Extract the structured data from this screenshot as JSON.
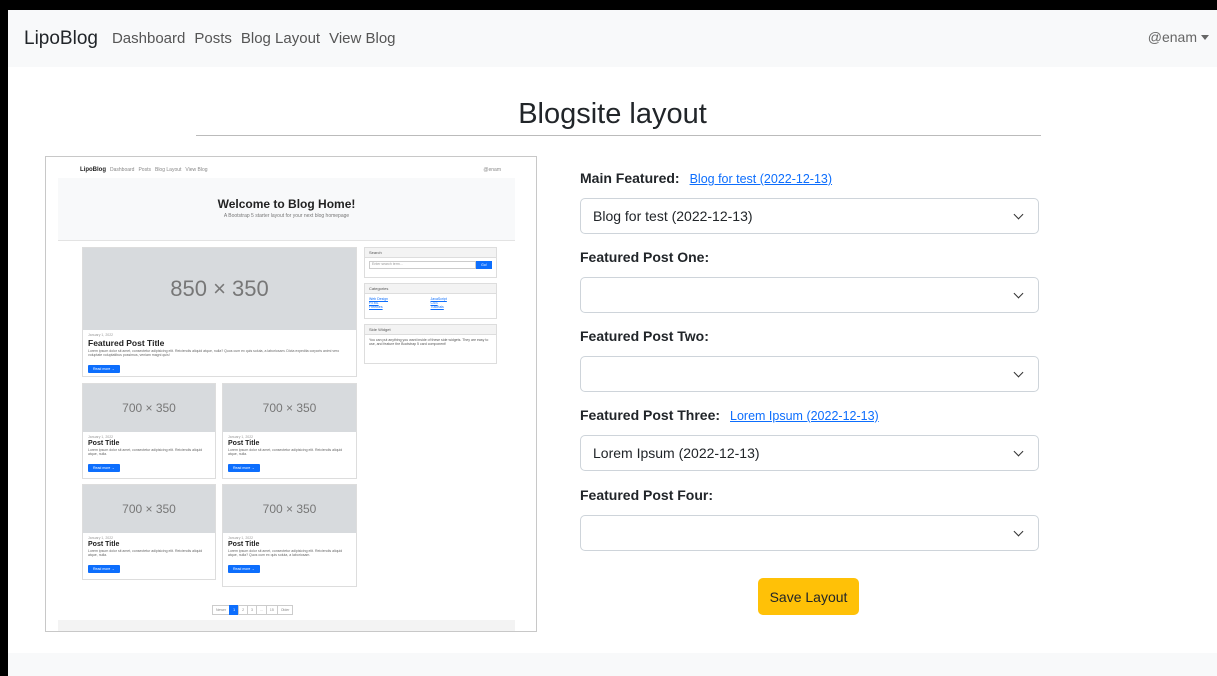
{
  "navbar": {
    "brand": "LipoBlog",
    "links": [
      "Dashboard",
      "Posts",
      "Blog Layout",
      "View Blog"
    ],
    "user": "@enam"
  },
  "page": {
    "title": "Blogsite layout"
  },
  "preview": {
    "nav_brand": "LipoBlog",
    "nav_links": [
      "Dashboard",
      "Posts",
      "Blog Layout",
      "View Blog"
    ],
    "nav_user": "@enam",
    "heading": "Welcome to Blog Home!",
    "lead": "A Bootstrap 5 starter layout for your next blog homepage",
    "featured": {
      "image": "850 × 350",
      "date": "January 1, 2022",
      "title": "Featured Post Title",
      "text": "Lorem ipsum dolor sit amet, consectetur adipisicing elit. Reiciendis aliquid atque, nulla? Quos cum ex quis soluta, a laboriosam. Dicta expedita corporis animi vero voluptate voluptatibus possimus, veniam magni quis!",
      "button": "Read more →"
    },
    "posts": [
      {
        "image": "700 × 350",
        "date": "January 1, 2022",
        "title": "Post Title",
        "text": "Lorem ipsum dolor sit amet, consectetur adipisicing elit. Reiciendis aliquid atque, nulla.",
        "button": "Read more →"
      },
      {
        "image": "700 × 350",
        "date": "January 1, 2022",
        "title": "Post Title",
        "text": "Lorem ipsum dolor sit amet, consectetur adipisicing elit. Reiciendis aliquid atque, nulla.",
        "button": "Read more →"
      },
      {
        "image": "700 × 350",
        "date": "January 1, 2022",
        "title": "Post Title",
        "text": "Lorem ipsum dolor sit amet, consectetur adipisicing elit. Reiciendis aliquid atque, nulla.",
        "button": "Read more →"
      },
      {
        "image": "700 × 350",
        "date": "January 1, 2022",
        "title": "Post Title",
        "text": "Lorem ipsum dolor sit amet, consectetur adipisicing elit. Reiciendis aliquid atque, nulla? Quos cum ex quis soluta, a laboriosam.",
        "button": "Read more →"
      }
    ],
    "search_title": "Search",
    "search_placeholder": "Enter search term...",
    "search_button": "Go!",
    "categories_title": "Categories",
    "categories_left": [
      "Web Design",
      "HTML",
      "Freebies"
    ],
    "categories_right": [
      "JavaScript",
      "CSS",
      "Tutorials"
    ],
    "widget_title": "Side Widget",
    "widget_text": "You can put anything you want inside of these side widgets. They are easy to use, and feature the Bootstrap 5 card component!",
    "pager": [
      "Newer",
      "1",
      "2",
      "3",
      "...",
      "15",
      "Older"
    ]
  },
  "form": {
    "fields": [
      {
        "label": "Main Featured:",
        "link": "Blog for test (2022-12-13)",
        "selected": "Blog for test (2022-12-13)"
      },
      {
        "label": "Featured Post One:",
        "link": "",
        "selected": ""
      },
      {
        "label": "Featured Post Two:",
        "link": "",
        "selected": ""
      },
      {
        "label": "Featured Post Three:",
        "link": "Lorem Ipsum (2022-12-13)",
        "selected": "Lorem Ipsum (2022-12-13)"
      },
      {
        "label": "Featured Post Four:",
        "link": "",
        "selected": ""
      }
    ],
    "save_label": "Save Layout"
  },
  "colors": {
    "primary": "#0d6efd",
    "warning": "#ffc107",
    "navbar_bg": "#f8f9fa"
  }
}
